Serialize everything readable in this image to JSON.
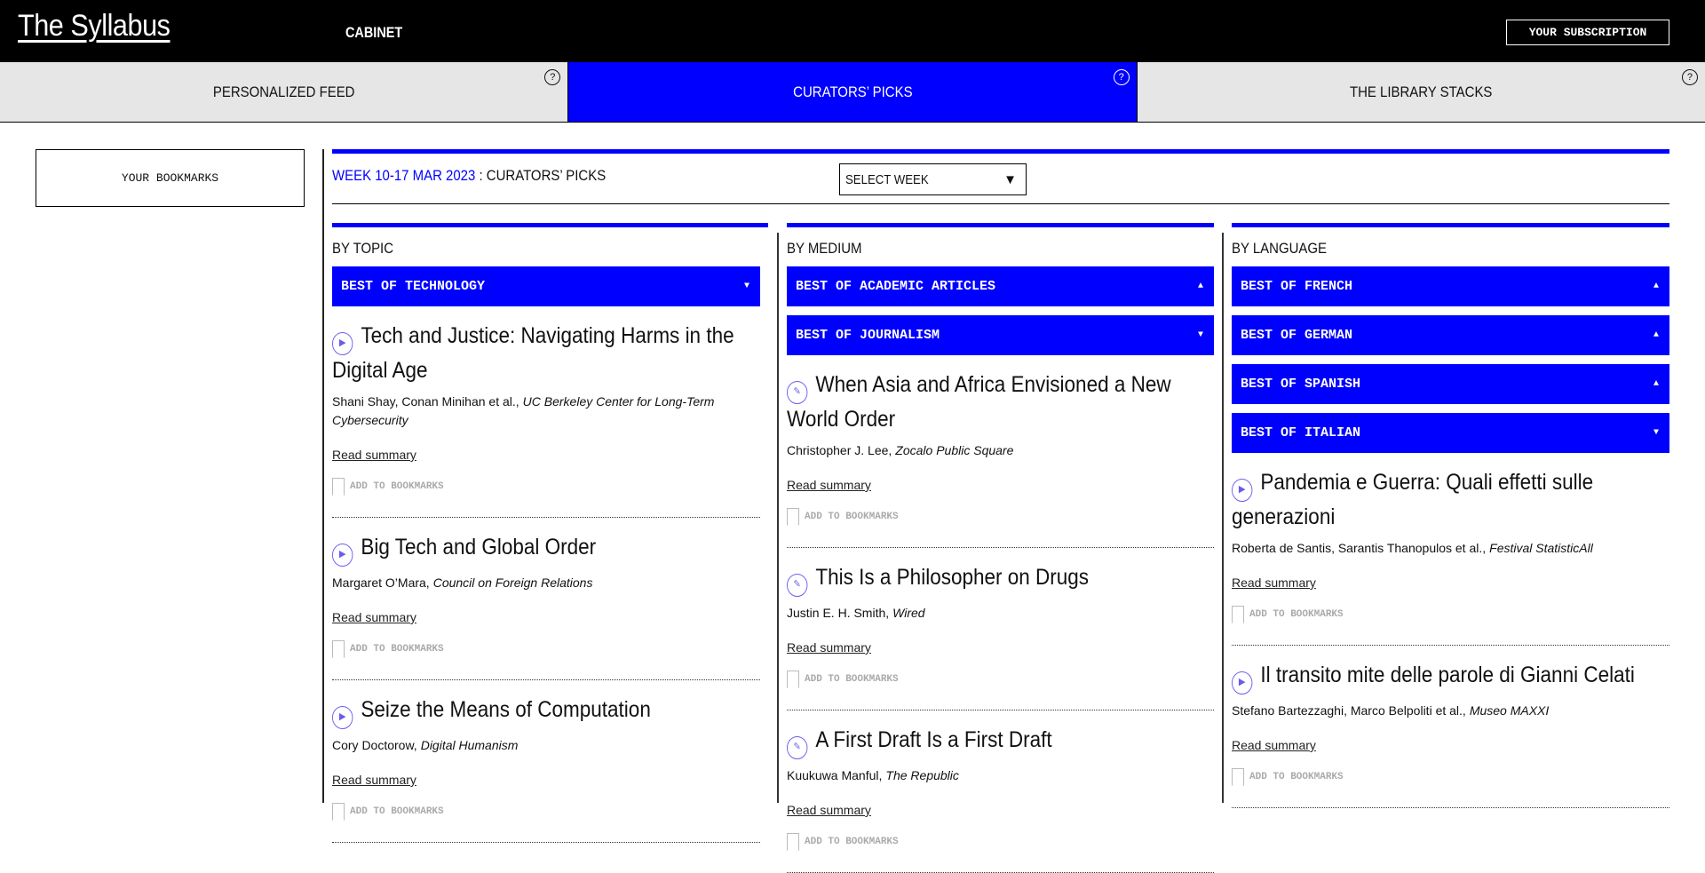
{
  "header": {
    "logo": "The Syllabus",
    "nav": "CABINET",
    "subscription": "YOUR SUBSCRIPTION"
  },
  "tabs": [
    {
      "label": "PERSONALIZED FEED",
      "active": false
    },
    {
      "label": "CURATORS’ PICKS",
      "active": true
    },
    {
      "label": "THE LIBRARY STACKS",
      "active": false
    }
  ],
  "help_icon": "?",
  "sidebar": {
    "bookmarks": "YOUR BOOKMARKS"
  },
  "week": {
    "range": "WEEK 10-17 MAR 2023",
    "suffix": " : CURATORS’ PICKS",
    "select_label": "SELECT WEEK"
  },
  "colors": {
    "accent": "#0000ff",
    "icon": "#6a5cf0"
  },
  "common": {
    "read_summary": "Read summary",
    "add_bookmark": "ADD TO BOOKMARKS"
  },
  "columns": [
    {
      "heading": "BY TOPIC",
      "dropdowns": [
        {
          "label": "BEST OF TECHNOLOGY",
          "state": "open"
        }
      ],
      "items": [
        {
          "icon": "video",
          "title": "Tech and Justice: Navigating Harms in the Digital Age",
          "authors": "Shani Shay, Conan Minihan et al.,",
          "source": "UC Berkeley Center for Long-Term Cybersecurity"
        },
        {
          "icon": "video",
          "title": "Big Tech and Global Order",
          "authors": "Margaret O’Mara,",
          "source": "Council on Foreign Relations"
        },
        {
          "icon": "video",
          "title": "Seize the Means of Computation",
          "authors": "Cory Doctorow,",
          "source": "Digital Humanism"
        }
      ]
    },
    {
      "heading": "BY MEDIUM",
      "dropdowns": [
        {
          "label": "BEST OF ACADEMIC ARTICLES",
          "state": "collapsed"
        },
        {
          "label": "BEST OF JOURNALISM",
          "state": "open"
        }
      ],
      "items": [
        {
          "icon": "pen",
          "title": "When Asia and Africa Envisioned a New World Order",
          "authors": "Christopher J. Lee,",
          "source": "Zocalo Public Square"
        },
        {
          "icon": "pen",
          "title": "This Is a Philosopher on Drugs",
          "authors": "Justin E. H. Smith,",
          "source": "Wired"
        },
        {
          "icon": "pen",
          "title": "A First Draft Is a First Draft",
          "authors": "Kuukuwa Manful,",
          "source": "The Republic"
        }
      ]
    },
    {
      "heading": "BY LANGUAGE",
      "dropdowns": [
        {
          "label": "BEST OF FRENCH",
          "state": "collapsed"
        },
        {
          "label": "BEST OF GERMAN",
          "state": "collapsed"
        },
        {
          "label": "BEST OF SPANISH",
          "state": "collapsed"
        },
        {
          "label": "BEST OF ITALIAN",
          "state": "open"
        }
      ],
      "items": [
        {
          "icon": "video",
          "title": "Pandemia e Guerra: Quali effetti sulle generazioni",
          "authors": "Roberta de Santis, Sarantis Thanopulos et al.,",
          "source": "Festival StatisticAll"
        },
        {
          "icon": "video",
          "title": "Il transito mite delle parole di Gianni Celati",
          "authors": "Stefano Bartezzaghi, Marco Belpoliti et al.,",
          "source": "Museo MAXXI"
        }
      ]
    }
  ]
}
